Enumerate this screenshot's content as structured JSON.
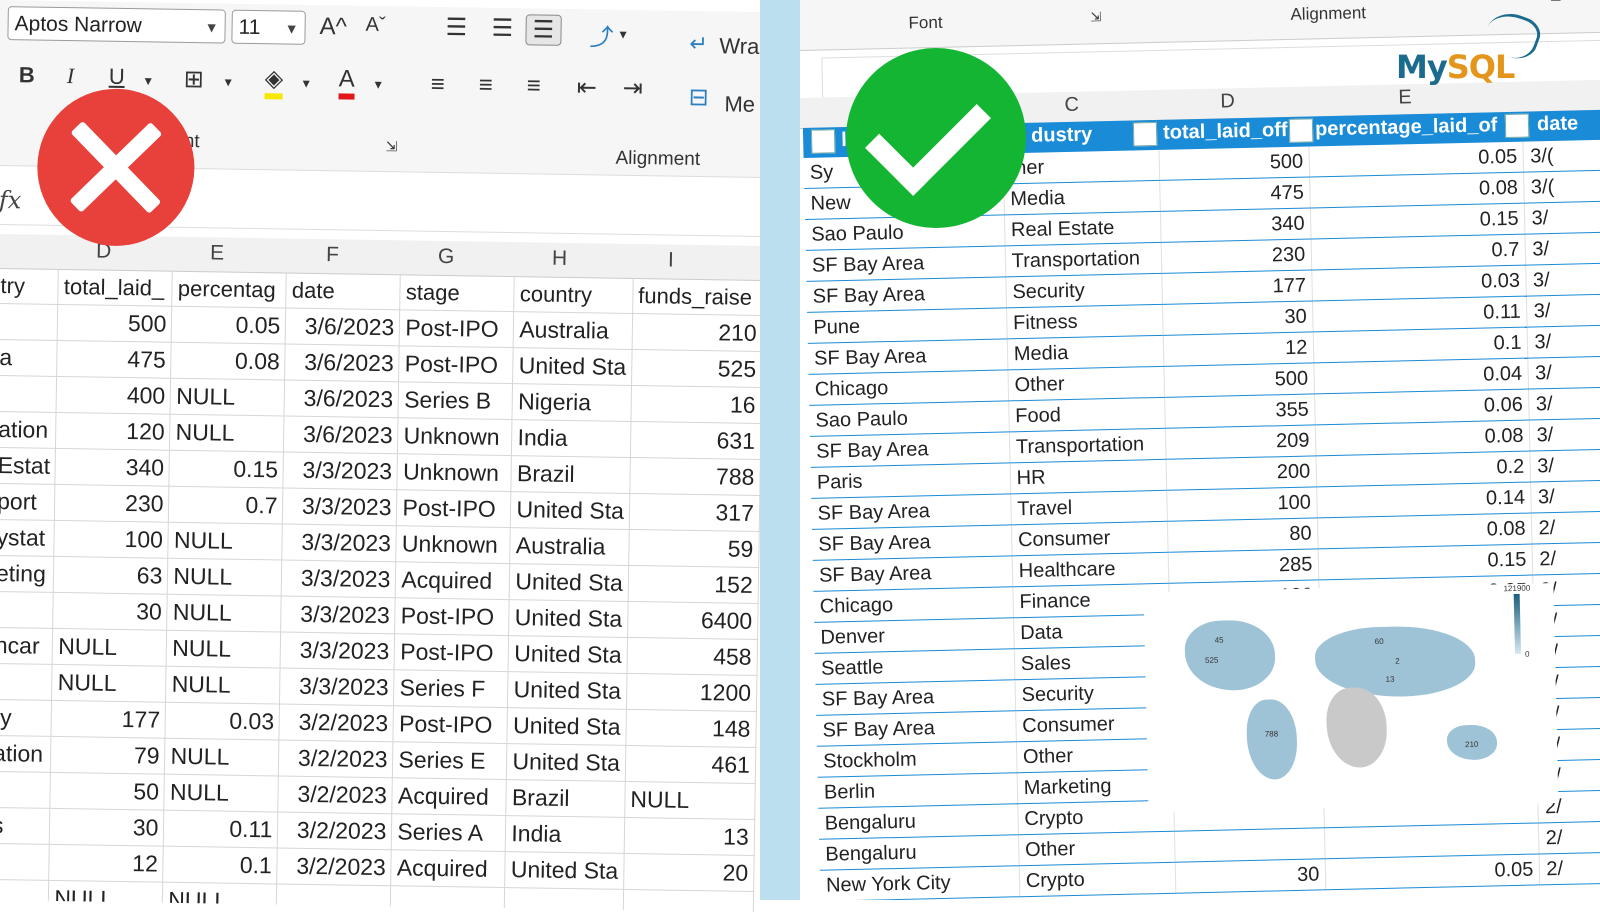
{
  "left": {
    "ribbon": {
      "font_name": "Aptos Narrow",
      "font_size": "11",
      "grow_font": "A^",
      "shrink_font": "Aˇ",
      "bold": "B",
      "italic": "I",
      "underline": "U",
      "font_group_label": "nt",
      "alignment_label": "Alignment",
      "wrap_text": "Wra",
      "merge": "Me"
    },
    "formula": {
      "fx": "fx"
    },
    "columns": [
      "D",
      "E",
      "F",
      "G",
      "H",
      "I"
    ],
    "headers": [
      "try",
      "total_laid_",
      "percentag",
      "date",
      "stage",
      "country",
      "funds_raise"
    ],
    "rows": [
      [
        "",
        "500",
        "0.05",
        "3/6/2023",
        "Post-IPO",
        "Australia",
        "210"
      ],
      [
        "a",
        "475",
        "0.08",
        "3/6/2023",
        "Post-IPO",
        "United Sta",
        "525"
      ],
      [
        "",
        "400",
        "NULL",
        "3/6/2023",
        "Series B",
        "Nigeria",
        "16"
      ],
      [
        "ation",
        "120",
        "NULL",
        "3/6/2023",
        "Unknown",
        "India",
        "631"
      ],
      [
        "Estat",
        "340",
        "0.15",
        "3/3/2023",
        "Unknown",
        "Brazil",
        "788"
      ],
      [
        "port",
        "230",
        "0.7",
        "3/3/2023",
        "Post-IPO",
        "United Sta",
        "317"
      ],
      [
        "ystat",
        "100",
        "NULL",
        "3/3/2023",
        "Unknown",
        "Australia",
        "59"
      ],
      [
        "eting",
        "63",
        "NULL",
        "3/3/2023",
        "Acquired",
        "United Sta",
        "152"
      ],
      [
        "",
        "30",
        "NULL",
        "3/3/2023",
        "Post-IPO",
        "United Sta",
        "6400"
      ],
      [
        "hcar",
        "NULL",
        "NULL",
        "3/3/2023",
        "Post-IPO",
        "United Sta",
        "458"
      ],
      [
        "",
        "NULL",
        "NULL",
        "3/3/2023",
        "Series F",
        "United Sta",
        "1200"
      ],
      [
        "ty",
        "177",
        "0.03",
        "3/2/2023",
        "Post-IPO",
        "United Sta",
        "148"
      ],
      [
        "ation",
        "79",
        "NULL",
        "3/2/2023",
        "Series E",
        "United Sta",
        "461"
      ],
      [
        "",
        "50",
        "NULL",
        "3/2/2023",
        "Acquired",
        "Brazil",
        "NULL"
      ],
      [
        "s",
        "30",
        "0.11",
        "3/2/2023",
        "Series A",
        "India",
        "13"
      ],
      [
        "",
        "12",
        "0.1",
        "3/2/2023",
        "Acquired",
        "United Sta",
        "20"
      ],
      [
        "",
        "NULL",
        "NULL",
        "",
        "",
        "",
        ""
      ]
    ]
  },
  "right": {
    "ribbon": {
      "font_label": "Font",
      "alignment_label": "Alignment"
    },
    "columns": [
      "C",
      "D",
      "E"
    ],
    "headers": [
      "l",
      "dustry",
      "total_laid_off",
      "percentage_laid_of",
      "date"
    ],
    "rows": [
      [
        "Sy",
        "ther",
        "500",
        "0.05",
        "3/("
      ],
      [
        "New",
        "Media",
        "475",
        "0.08",
        "3/("
      ],
      [
        "Sao Paulo",
        "Real Estate",
        "340",
        "0.15",
        "3/"
      ],
      [
        "SF Bay Area",
        "Transportation",
        "230",
        "0.7",
        "3/"
      ],
      [
        "SF Bay Area",
        "Security",
        "177",
        "0.03",
        "3/"
      ],
      [
        "Pune",
        "Fitness",
        "30",
        "0.11",
        "3/"
      ],
      [
        "SF Bay Area",
        "Media",
        "12",
        "0.1",
        "3/"
      ],
      [
        "Chicago",
        "Other",
        "500",
        "0.04",
        "3/"
      ],
      [
        "Sao Paulo",
        "Food",
        "355",
        "0.06",
        "3/"
      ],
      [
        "SF Bay Area",
        "Transportation",
        "209",
        "0.08",
        "3/"
      ],
      [
        "Paris",
        "HR",
        "200",
        "0.2",
        "3/"
      ],
      [
        "SF Bay Area",
        "Travel",
        "100",
        "0.14",
        "3/"
      ],
      [
        "SF Bay Area",
        "Consumer",
        "80",
        "0.08",
        "2/"
      ],
      [
        "SF Bay Area",
        "Healthcare",
        "285",
        "0.15",
        "2/"
      ],
      [
        "Chicago",
        "Finance",
        "130",
        "0.25",
        "2/"
      ],
      [
        "Denver",
        "Data",
        "",
        "",
        "2/"
      ],
      [
        "Seattle",
        "Sales",
        "",
        "",
        "2/"
      ],
      [
        "SF Bay Area",
        "Security",
        "",
        "",
        "2/"
      ],
      [
        "SF Bay Area",
        "Consumer",
        "",
        "",
        "2/"
      ],
      [
        "Stockholm",
        "Other",
        "",
        "",
        "2/"
      ],
      [
        "Berlin",
        "Marketing",
        "",
        "",
        "2/"
      ],
      [
        "Bengaluru",
        "Crypto",
        "",
        "",
        "2/"
      ],
      [
        "Bengaluru",
        "Other",
        "",
        "",
        "2/"
      ],
      [
        "New York City",
        "Crypto",
        "30",
        "0.05",
        "2/"
      ]
    ],
    "map": {
      "legend_max": "121900",
      "legend_min": "0",
      "labels": [
        "45",
        "525",
        "60",
        "2",
        "13",
        "788",
        "210"
      ]
    },
    "brand": {
      "my": "My",
      "sql": "SQL"
    }
  },
  "colors": {
    "red": "#e8403a",
    "green": "#14b533",
    "header_blue": "#1a8bd6",
    "separator": "#bcdff0"
  }
}
